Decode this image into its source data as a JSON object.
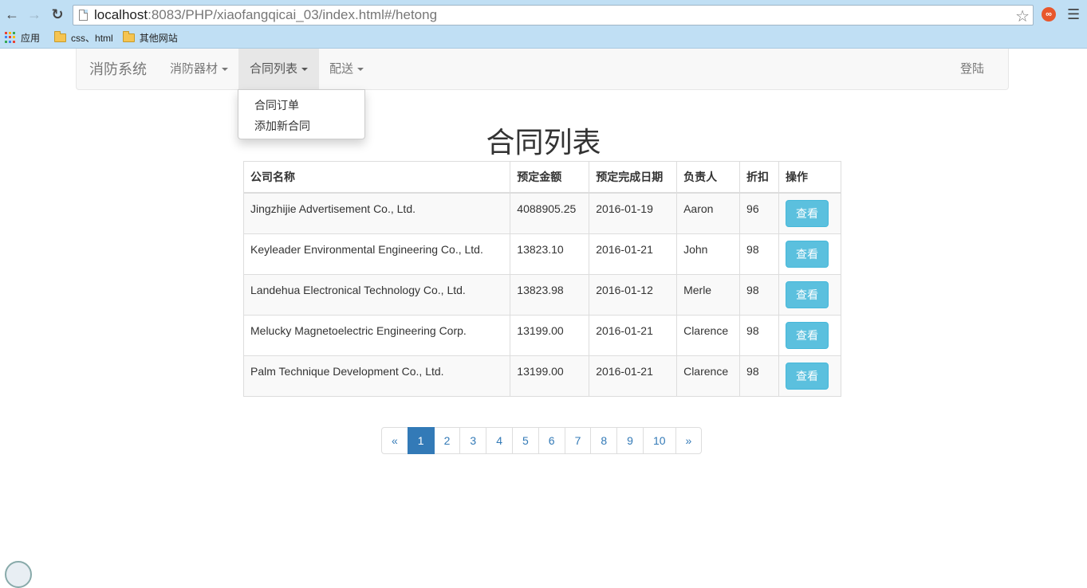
{
  "browser": {
    "url_host": "localhost",
    "url_rest": ":8083/PHP/xiaofangqicai_03/index.html#/hetong",
    "bookmarks": [
      "应用",
      "css、html",
      "其他网站"
    ],
    "ext_label": "∞"
  },
  "navbar": {
    "brand": "消防系统",
    "items": [
      {
        "label": "消防器材"
      },
      {
        "label": "合同列表"
      },
      {
        "label": "配送"
      }
    ],
    "login": "登陆"
  },
  "dropdown": {
    "items": [
      "合同订单",
      "添加新合同"
    ]
  },
  "page": {
    "title": "合同列表"
  },
  "table": {
    "headers": [
      "公司名称",
      "预定金额",
      "预定完成日期",
      "负责人",
      "折扣",
      "操作"
    ],
    "rows": [
      {
        "company": "Jingzhijie Advertisement Co., Ltd.",
        "amount": "4088905.25",
        "date": "2016-01-19",
        "owner": "Aaron",
        "discount": "96",
        "action": "查看"
      },
      {
        "company": "Keyleader Environmental Engineering Co., Ltd.",
        "amount": "13823.10",
        "date": "2016-01-21",
        "owner": "John",
        "discount": "98",
        "action": "查看"
      },
      {
        "company": "Landehua Electronical Technology Co., Ltd.",
        "amount": "13823.98",
        "date": "2016-01-12",
        "owner": "Merle",
        "discount": "98",
        "action": "查看"
      },
      {
        "company": "Melucky Magnetoelectric Engineering Corp.",
        "amount": "13199.00",
        "date": "2016-01-21",
        "owner": "Clarence",
        "discount": "98",
        "action": "查看"
      },
      {
        "company": "Palm Technique Development Co., Ltd.",
        "amount": "13199.00",
        "date": "2016-01-21",
        "owner": "Clarence",
        "discount": "98",
        "action": "查看"
      }
    ]
  },
  "pagination": {
    "prev": "«",
    "next": "»",
    "pages": [
      "1",
      "2",
      "3",
      "4",
      "5",
      "6",
      "7",
      "8",
      "9",
      "10"
    ],
    "current": "1"
  },
  "colors": {
    "chrome": "#c0dff4",
    "primary": "#337ab7",
    "info_button": "#5bc0de"
  },
  "icons": [
    "back-icon",
    "forward-icon",
    "reload-icon",
    "page-icon",
    "star-icon",
    "extension-icon",
    "menu-icon",
    "apps-icon",
    "folder-icon",
    "caret-down-icon"
  ]
}
